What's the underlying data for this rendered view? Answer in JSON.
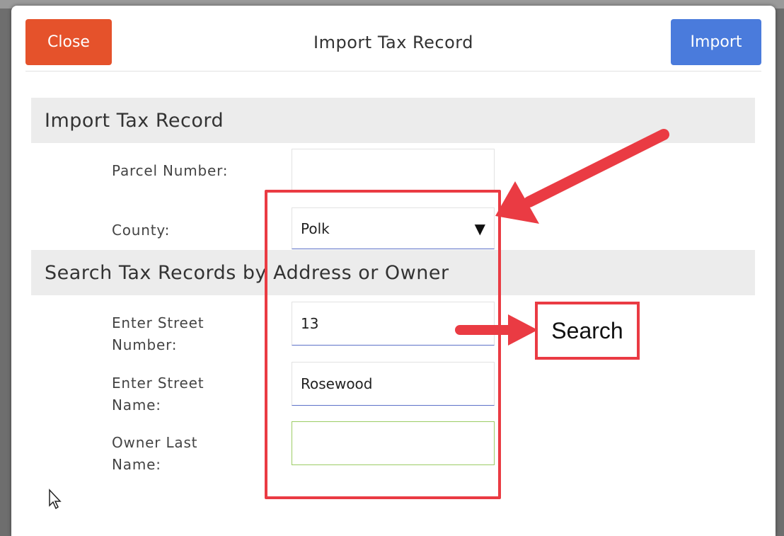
{
  "dialog": {
    "title": "Import Tax Record",
    "close_label": "Close",
    "import_label": "Import"
  },
  "sections": {
    "import": "Import Tax Record",
    "search": "Search Tax Records by Address or Owner"
  },
  "fields": {
    "parcel_number": {
      "label": "Parcel Number:",
      "value": ""
    },
    "county": {
      "label": "County:",
      "value": "Polk"
    },
    "street_number": {
      "label_line1": "Enter Street",
      "label_line2": "Number:",
      "value": "13"
    },
    "street_name": {
      "label_line1": "Enter Street",
      "label_line2": "Name:",
      "value": "Rosewood"
    },
    "owner_last_name": {
      "label_line1": "Owner Last",
      "label_line2": "Name:",
      "value": ""
    }
  },
  "annotation": {
    "search_label": "Search"
  },
  "colors": {
    "close": "#e5522b",
    "import": "#4a7bdc",
    "annotation": "#ea3b43",
    "input_focus": "#5d72c8",
    "input_valid": "#9ccc65"
  },
  "icons": {
    "dropdown": "caret-down-icon",
    "cursor": "mouse-pointer-icon"
  }
}
